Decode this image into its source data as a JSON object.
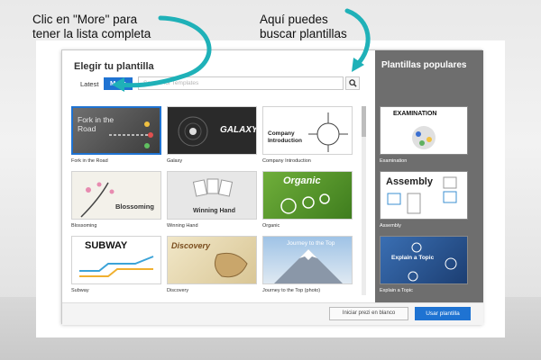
{
  "annotations": {
    "left_line1": "Clic en \"More\" para",
    "left_line2": "tener la lista completa",
    "right_line1": "Aquí puedes",
    "right_line2": "buscar plantillas"
  },
  "dialog": {
    "title": "Elegir tu plantilla",
    "tabs": {
      "latest": "Latest",
      "more": "More"
    },
    "search": {
      "placeholder": "Search for Templates",
      "value": ""
    }
  },
  "templates": [
    {
      "label": "Fork in the Road",
      "art_title": "Fork in the Road",
      "selected": true
    },
    {
      "label": "Galaxy",
      "art_title": "GALAXY"
    },
    {
      "label": "Company Introduction",
      "art_title": "Company Introduction"
    },
    {
      "label": "Blossoming",
      "art_title": "Blossoming"
    },
    {
      "label": "Winning Hand",
      "art_title": "Winning Hand"
    },
    {
      "label": "Organic",
      "art_title": "Organic"
    },
    {
      "label": "Subway",
      "art_title": "SUBWAY"
    },
    {
      "label": "Discovery",
      "art_title": "Discovery"
    },
    {
      "label": "Journey to the Top (photo)",
      "art_title": "Journey to the Top"
    }
  ],
  "popular": {
    "title": "Plantillas populares",
    "items": [
      {
        "label": "Examination",
        "art_title": "EXAMINATION"
      },
      {
        "label": "Assembly",
        "art_title": "Assembly"
      },
      {
        "label": "Explain a Topic",
        "art_title": "Explain a Topic"
      }
    ]
  },
  "footer": {
    "blank_button": "Iniciar prezi en blanco",
    "use_button": "Usar plantilla"
  },
  "colors": {
    "accent_blue": "#1f73d2",
    "side_panel": "#6e6e6e",
    "arrow_teal": "#1fb1b8"
  }
}
